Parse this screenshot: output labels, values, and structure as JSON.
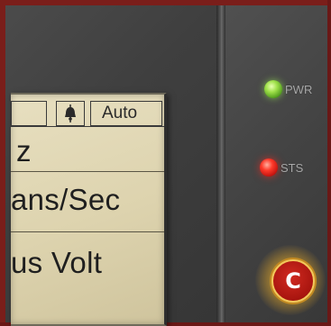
{
  "lcd": {
    "header_auto": "Auto",
    "line_1": "z",
    "line_2": "ans/Sec",
    "line_3": "us Volt"
  },
  "indicators": {
    "pwr": {
      "label": "PWR",
      "color": "#7cd23a"
    },
    "sts": {
      "label": "STS",
      "color": "#e3201a"
    }
  },
  "callout": {
    "letter": "C",
    "color": "#b3140f"
  },
  "icons": {
    "bell": "bell-icon"
  }
}
